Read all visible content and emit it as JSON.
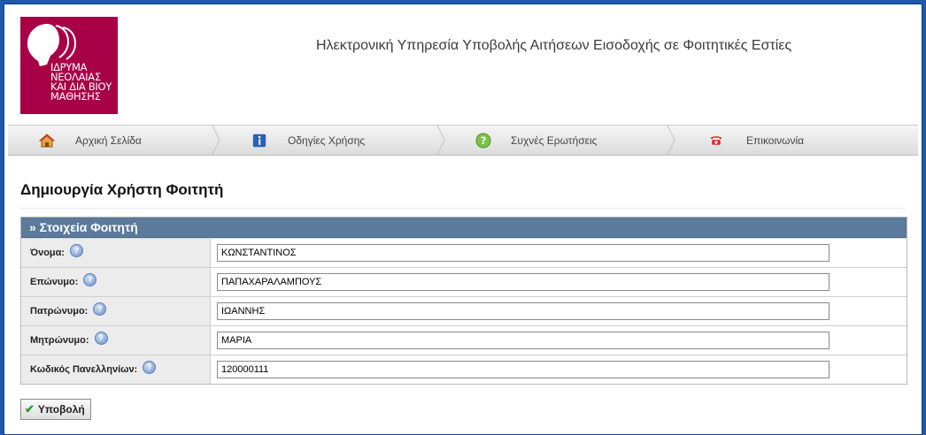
{
  "header": {
    "logo_lines": [
      "ΙΔΡΥΜΑ",
      "ΝΕΟΛΑΙΑΣ",
      "ΚΑΙ ΔΙΑ ΒΙΟΥ",
      "ΜΑΘΗΣΗΣ"
    ],
    "site_title": "Ηλεκτρονική Υπηρεσία Υποβολής Αιτήσεων Εισοδοχής σε Φοιτητικές Εστίες",
    "brand_color": "#a80047"
  },
  "nav": {
    "items": [
      {
        "label": "Αρχική Σελίδα",
        "icon": "home-icon"
      },
      {
        "label": "Οδηγίες Χρήσης",
        "icon": "info-icon"
      },
      {
        "label": "Συχνές Ερωτήσεις",
        "icon": "question-icon"
      },
      {
        "label": "Επικοινωνία",
        "icon": "phone-icon"
      }
    ]
  },
  "page": {
    "title": "Δημιουργία Χρήστη Φοιτητή",
    "section_title": "» Στοιχεία Φοιτητή",
    "section_color": "#5b7a9c"
  },
  "form": {
    "fields": [
      {
        "label": "Όνομα:",
        "value": "ΚΩΝΣΤΑΝΤΙΝΟΣ"
      },
      {
        "label": "Επώνυμο:",
        "value": "ΠΑΠΑΧΑΡΑΛΑΜΠΟΥΣ"
      },
      {
        "label": "Πατρώνυμο:",
        "value": "ΙΩΑΝΝΗΣ"
      },
      {
        "label": "Μητρώνυμο:",
        "value": "ΜΑΡΙΑ"
      },
      {
        "label": "Κωδικός Πανελληνίων:",
        "value": "120000111"
      }
    ],
    "submit_label": "Υποβολή"
  }
}
